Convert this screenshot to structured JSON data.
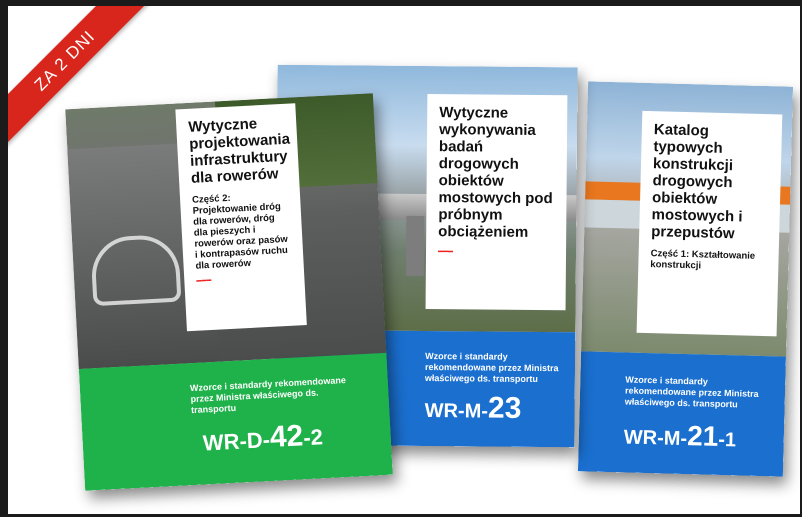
{
  "ribbon": {
    "label": "ZA 2 DNI",
    "color": "#d9261c"
  },
  "books": [
    {
      "color": "#1fb14a",
      "title": "Wytyczne projektowania infrastruktury dla rowerów",
      "part": "Część 2: Projektowanie dróg dla rowerów, dróg dla pieszych i rowerów oraz pasów i kontrapasów ruchu dla rowerów",
      "slogan": "Wzorce i standardy rekomendowane przez Ministra właściwego ds. transportu",
      "code_prefix": "WR-D-",
      "code_number": "42",
      "code_suffix": "-2"
    },
    {
      "color": "#1a6fcf",
      "title": "Wytyczne wykonywania badań drogowych obiektów mostowych pod próbnym obciążeniem",
      "part": "",
      "slogan": "Wzorce i standardy rekomendowane przez Ministra właściwego ds. transportu",
      "code_prefix": "WR-M-",
      "code_number": "23",
      "code_suffix": ""
    },
    {
      "color": "#1a6fcf",
      "title": "Katalog typowych konstrukcji drogowych obiektów mostowych i przepustów",
      "part": "Część 1: Kształtowanie konstrukcji",
      "slogan": "Wzorce i standardy rekomendowane przez Ministra właściwego ds. transportu",
      "code_prefix": "WR-M-",
      "code_number": "21",
      "code_suffix": "-1"
    }
  ]
}
